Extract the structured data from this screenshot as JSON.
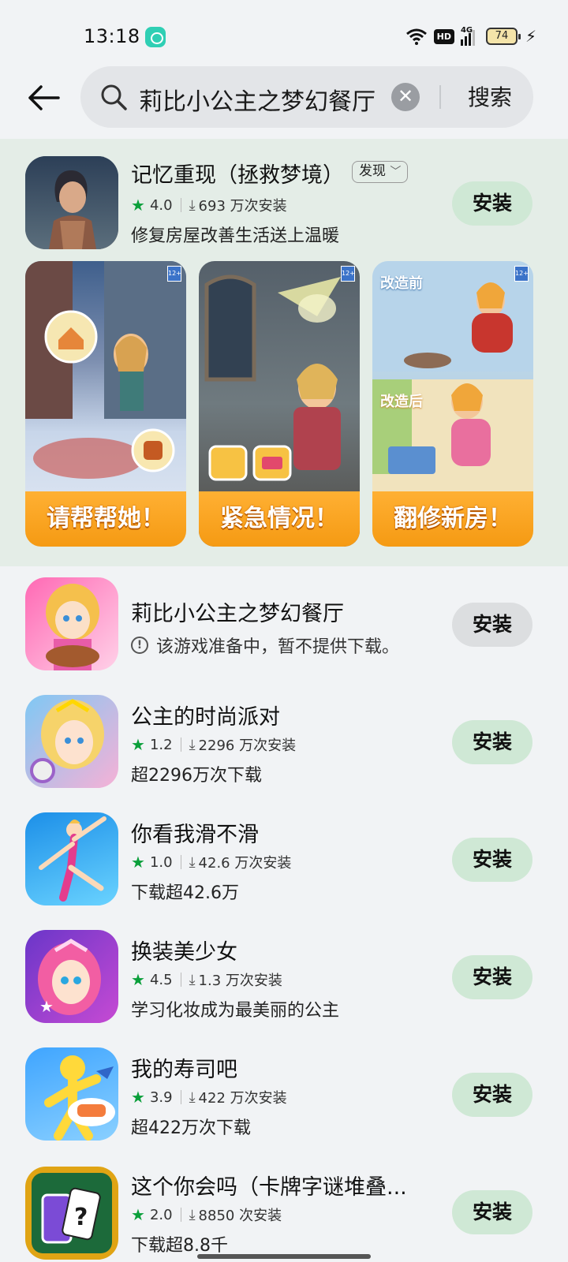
{
  "status_bar": {
    "time": "13:18",
    "hd": "HD",
    "network": "4G",
    "battery": "74"
  },
  "search": {
    "query": "莉比小公主之梦幻餐厅",
    "button_label": "搜索"
  },
  "featured": {
    "title": "记忆重现（拯救梦境）",
    "tag": "发现",
    "rating": "4.0",
    "installs": "693 万次安装",
    "description": "修复房屋改善生活送上温暖",
    "install_label": "安装",
    "screenshots": [
      {
        "caption": "请帮帮她！",
        "badge": "12+"
      },
      {
        "caption": "紧急情况！",
        "badge": "12+"
      },
      {
        "caption": "翻修新房！",
        "badge": "12+",
        "label_before": "改造前",
        "label_after": "改造后"
      }
    ]
  },
  "apps": [
    {
      "title": "莉比小公主之梦幻餐厅",
      "notice": "该游戏准备中，暂不提供下载。",
      "install_label": "安装",
      "disabled": true
    },
    {
      "title": "公主的时尚派对",
      "rating": "1.2",
      "installs": "2296 万次安装",
      "description": "超2296万次下载",
      "install_label": "安装"
    },
    {
      "title": "你看我滑不滑",
      "rating": "1.0",
      "installs": "42.6 万次安装",
      "description": "下载超42.6万",
      "install_label": "安装"
    },
    {
      "title": "换装美少女",
      "rating": "4.5",
      "installs": "1.3 万次安装",
      "description": "学习化妆成为最美丽的公主",
      "install_label": "安装"
    },
    {
      "title": "我的寿司吧",
      "rating": "3.9",
      "installs": "422 万次安装",
      "description": "超422万次下载",
      "install_label": "安装"
    },
    {
      "title": "这个你会吗（卡牌字谜堆叠...",
      "rating": "2.0",
      "installs": "8850 次安装",
      "description": "下载超8.8千",
      "install_label": "安装"
    }
  ],
  "colors": {
    "install_bg": "#cfe8d5",
    "featured_bg": "#e4ede7",
    "star": "#0a9f3a"
  }
}
